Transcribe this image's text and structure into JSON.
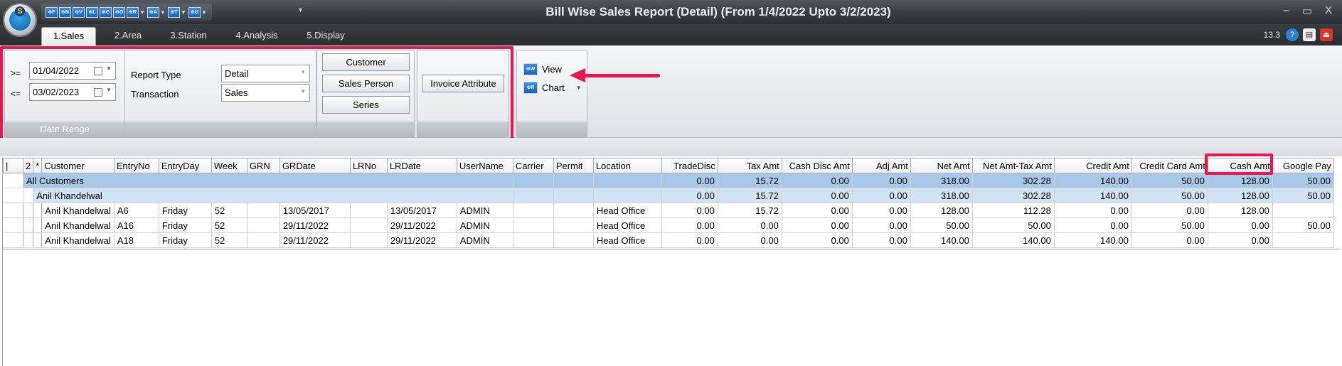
{
  "window": {
    "title": "Bill Wise Sales Report (Detail) (From 1/4/2022 Upto 3/2/2023)",
    "version": "13.3",
    "controls": [
      "–",
      "▭",
      "X"
    ]
  },
  "quick_access": [
    {
      "code": "⊕F",
      "name": "f"
    },
    {
      "code": "⊕N",
      "name": "n"
    },
    {
      "code": "⊕V",
      "name": "v"
    },
    {
      "code": "⊕L",
      "name": "l"
    },
    {
      "code": "⊕G",
      "name": "g"
    },
    {
      "code": "⊕O",
      "name": "o"
    },
    {
      "code": "⊕R",
      "name": "r"
    },
    {
      "code": "⊕A",
      "name": "a"
    },
    {
      "code": "⊕T",
      "name": "t"
    },
    {
      "code": "⊕U",
      "name": "u"
    }
  ],
  "tabs": [
    {
      "label": "1.Sales",
      "active": true
    },
    {
      "label": "2.Area",
      "active": false
    },
    {
      "label": "3.Station",
      "active": false
    },
    {
      "label": "4.Analysis",
      "active": false
    },
    {
      "label": "5.Display",
      "active": false
    }
  ],
  "date_range": {
    "from_op": ">=",
    "from_value": "01/04/2022",
    "to_op": "<=",
    "to_value": "03/02/2023",
    "footer": "Date Range"
  },
  "report": {
    "type_label": "Report Type",
    "type_value": "Detail",
    "transaction_label": "Transaction",
    "transaction_value": "Sales"
  },
  "filters": {
    "customer": "Customer",
    "sales_person": "Sales Person",
    "series": "Series",
    "invoice_attribute": "Invoice Attribute"
  },
  "actions": {
    "view_icon": "⊕W",
    "view": "View",
    "chart_icon": "⊕R",
    "chart": "Chart"
  },
  "grid": {
    "columns": [
      "|",
      "2",
      "*",
      "Customer",
      "EntryNo",
      "EntryDay",
      "Week",
      "GRN",
      "GRDate",
      "LRNo",
      "LRDate",
      "UserName",
      "Carrier",
      "Permit",
      "Location",
      "TradeDisc",
      "Tax Amt",
      "Cash Disc Amt",
      "Adj Amt",
      "Net Amt",
      "Net Amt-Tax Amt",
      "Credit Amt",
      "Credit Card Amt",
      "Cash Amt",
      "Google Pay"
    ],
    "group_all": {
      "label": "All Customers",
      "TradeDisc": "0.00",
      "TaxAmt": "15.72",
      "CashDiscAmt": "0.00",
      "AdjAmt": "0.00",
      "NetAmt": "318.00",
      "NetAmtTaxAmt": "302.28",
      "CreditAmt": "140.00",
      "CreditCardAmt": "50.00",
      "CashAmt": "128.00",
      "GooglePay": "50.00"
    },
    "group_customer": {
      "label": "Anil Khandelwal",
      "TradeDisc": "0.00",
      "TaxAmt": "15.72",
      "CashDiscAmt": "0.00",
      "AdjAmt": "0.00",
      "NetAmt": "318.00",
      "NetAmtTaxAmt": "302.28",
      "CreditAmt": "140.00",
      "CreditCardAmt": "50.00",
      "CashAmt": "128.00",
      "GooglePay": "50.00"
    },
    "rows": [
      {
        "Customer": "Anil Khandelwal",
        "EntryNo": "A6",
        "EntryDay": "Friday",
        "Week": "52",
        "GRN": "",
        "GRDate": "13/05/2017",
        "LRNo": "",
        "LRDate": "13/05/2017",
        "UserName": "ADMIN",
        "Carrier": "",
        "Permit": "",
        "Location": "Head Office",
        "TradeDisc": "0.00",
        "TaxAmt": "15.72",
        "CashDiscAmt": "0.00",
        "AdjAmt": "0.00",
        "NetAmt": "128.00",
        "NetAmtTaxAmt": "112.28",
        "CreditAmt": "0.00",
        "CreditCardAmt": "0.00",
        "CashAmt": "128.00",
        "GooglePay": ""
      },
      {
        "Customer": "Anil Khandelwal",
        "EntryNo": "A16",
        "EntryDay": "Friday",
        "Week": "52",
        "GRN": "",
        "GRDate": "29/11/2022",
        "LRNo": "",
        "LRDate": "29/11/2022",
        "UserName": "ADMIN",
        "Carrier": "",
        "Permit": "",
        "Location": "Head Office",
        "TradeDisc": "0.00",
        "TaxAmt": "0.00",
        "CashDiscAmt": "0.00",
        "AdjAmt": "0.00",
        "NetAmt": "50.00",
        "NetAmtTaxAmt": "50.00",
        "CreditAmt": "0.00",
        "CreditCardAmt": "50.00",
        "CashAmt": "0.00",
        "GooglePay": "50.00"
      },
      {
        "Customer": "Anil Khandelwal",
        "EntryNo": "A18",
        "EntryDay": "Friday",
        "Week": "52",
        "GRN": "",
        "GRDate": "29/11/2022",
        "LRNo": "",
        "LRDate": "29/11/2022",
        "UserName": "ADMIN",
        "Carrier": "",
        "Permit": "",
        "Location": "Head Office",
        "TradeDisc": "0.00",
        "TaxAmt": "0.00",
        "CashDiscAmt": "0.00",
        "AdjAmt": "0.00",
        "NetAmt": "140.00",
        "NetAmtTaxAmt": "140.00",
        "CreditAmt": "140.00",
        "CreditCardAmt": "0.00",
        "CashAmt": "0.00",
        "GooglePay": ""
      }
    ]
  },
  "colors": {
    "annotation": "#e8174f",
    "group_row": "#a9c8e8",
    "subgroup_row": "#d2e3f4",
    "qat_icon": "#1565c0"
  }
}
